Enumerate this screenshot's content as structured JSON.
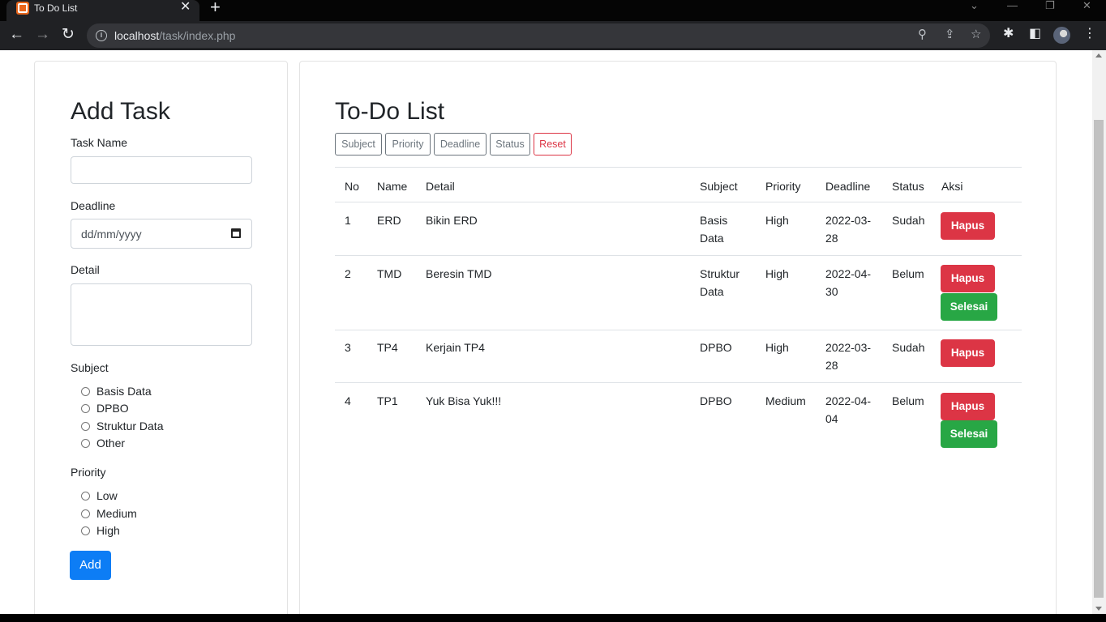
{
  "browser": {
    "tab_title": "To Do List",
    "tab_close": "✕",
    "new_tab": "+",
    "url_host": "localhost",
    "url_path": "/task/index.php",
    "win_minimize": "—",
    "win_restore": "❐",
    "win_close": "✕",
    "win_chevron": "⌄"
  },
  "add_task": {
    "title": "Add Task",
    "task_name_label": "Task Name",
    "task_name_value": "",
    "deadline_label": "Deadline",
    "deadline_placeholder": "dd/mm/yyyy",
    "detail_label": "Detail",
    "detail_value": "",
    "subject_label": "Subject",
    "subjects": [
      "Basis Data",
      "DPBO",
      "Struktur Data",
      "Other"
    ],
    "priority_label": "Priority",
    "priorities": [
      "Low",
      "Medium",
      "High"
    ],
    "add_button": "Add"
  },
  "todo": {
    "title": "To-Do List",
    "filters": [
      "Subject",
      "Priority",
      "Deadline",
      "Status"
    ],
    "reset": "Reset",
    "columns": [
      "No",
      "Name",
      "Detail",
      "Subject",
      "Priority",
      "Deadline",
      "Status",
      "Aksi"
    ],
    "rows": [
      {
        "no": "1",
        "name": "ERD",
        "detail": "Bikin ERD",
        "subject": [
          "Basis",
          "Data"
        ],
        "priority": "High",
        "deadline": [
          "2022-03-",
          "28"
        ],
        "status": "Sudah",
        "actions": [
          "Hapus"
        ]
      },
      {
        "no": "2",
        "name": "TMD",
        "detail": "Beresin TMD",
        "subject": [
          "Struktur",
          "Data"
        ],
        "priority": "High",
        "deadline": [
          "2022-04-",
          "30"
        ],
        "status": "Belum",
        "actions": [
          "Hapus",
          "Selesai"
        ]
      },
      {
        "no": "3",
        "name": "TP4",
        "detail": "Kerjain TP4",
        "subject": [
          "DPBO"
        ],
        "priority": "High",
        "deadline": [
          "2022-03-",
          "28"
        ],
        "status": "Sudah",
        "actions": [
          "Hapus"
        ]
      },
      {
        "no": "4",
        "name": "TP1",
        "detail": "Yuk Bisa Yuk!!!",
        "subject": [
          "DPBO"
        ],
        "priority": "Medium",
        "deadline": [
          "2022-04-",
          "04"
        ],
        "status": "Belum",
        "actions": [
          "Hapus",
          "Selesai"
        ]
      }
    ]
  },
  "colors": {
    "primary": "#0d7df5",
    "danger": "#dc3545",
    "success": "#28a745",
    "secondary": "#6c757d"
  }
}
